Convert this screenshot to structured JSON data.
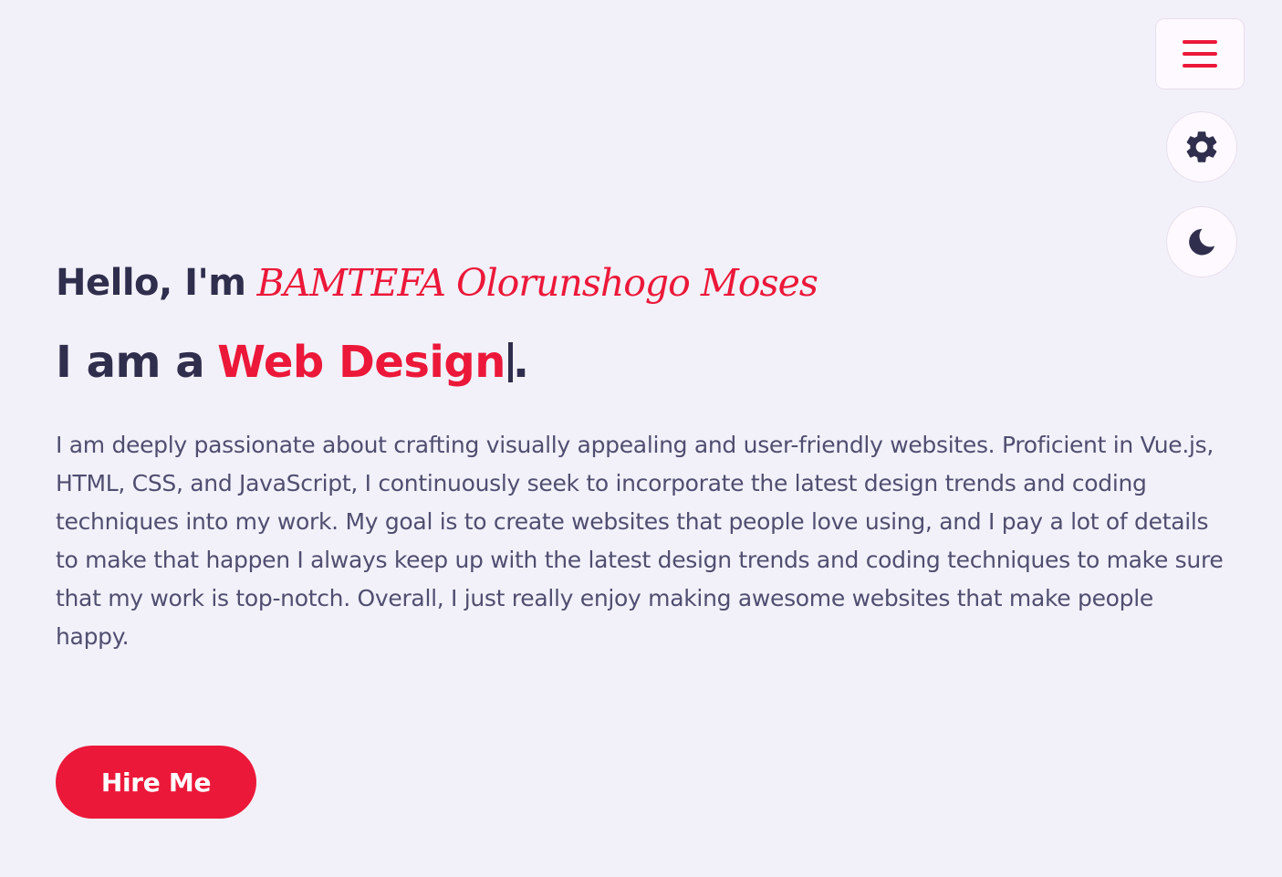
{
  "colors": {
    "background": "#f2f1fa",
    "accent": "#ec1839",
    "heading": "#302e4d",
    "body_text": "#504e70",
    "button_text": "#ffffff"
  },
  "controls": {
    "menu_icon": "hamburger-menu-icon",
    "settings_icon": "gear-icon",
    "theme_icon": "moon-icon"
  },
  "hero": {
    "greeting": "Hello, I'm",
    "name": "BAMTEFA Olorunshogo Moses",
    "role_prefix": "I am a",
    "role_typed": "Web Design",
    "role_suffix": ".",
    "about": "I am deeply passionate about crafting visually appealing and user-friendly websites. Proficient in Vue.js, HTML, CSS, and JavaScript, I continuously seek to incorporate the latest design trends and coding techniques into my work. My goal is to create websites that people love using, and I pay a lot of details to make that happen I always keep up with the latest design trends and coding techniques to make sure that my work is top-notch. Overall, I just really enjoy making awesome websites that make people happy.",
    "cta_label": "Hire Me"
  }
}
